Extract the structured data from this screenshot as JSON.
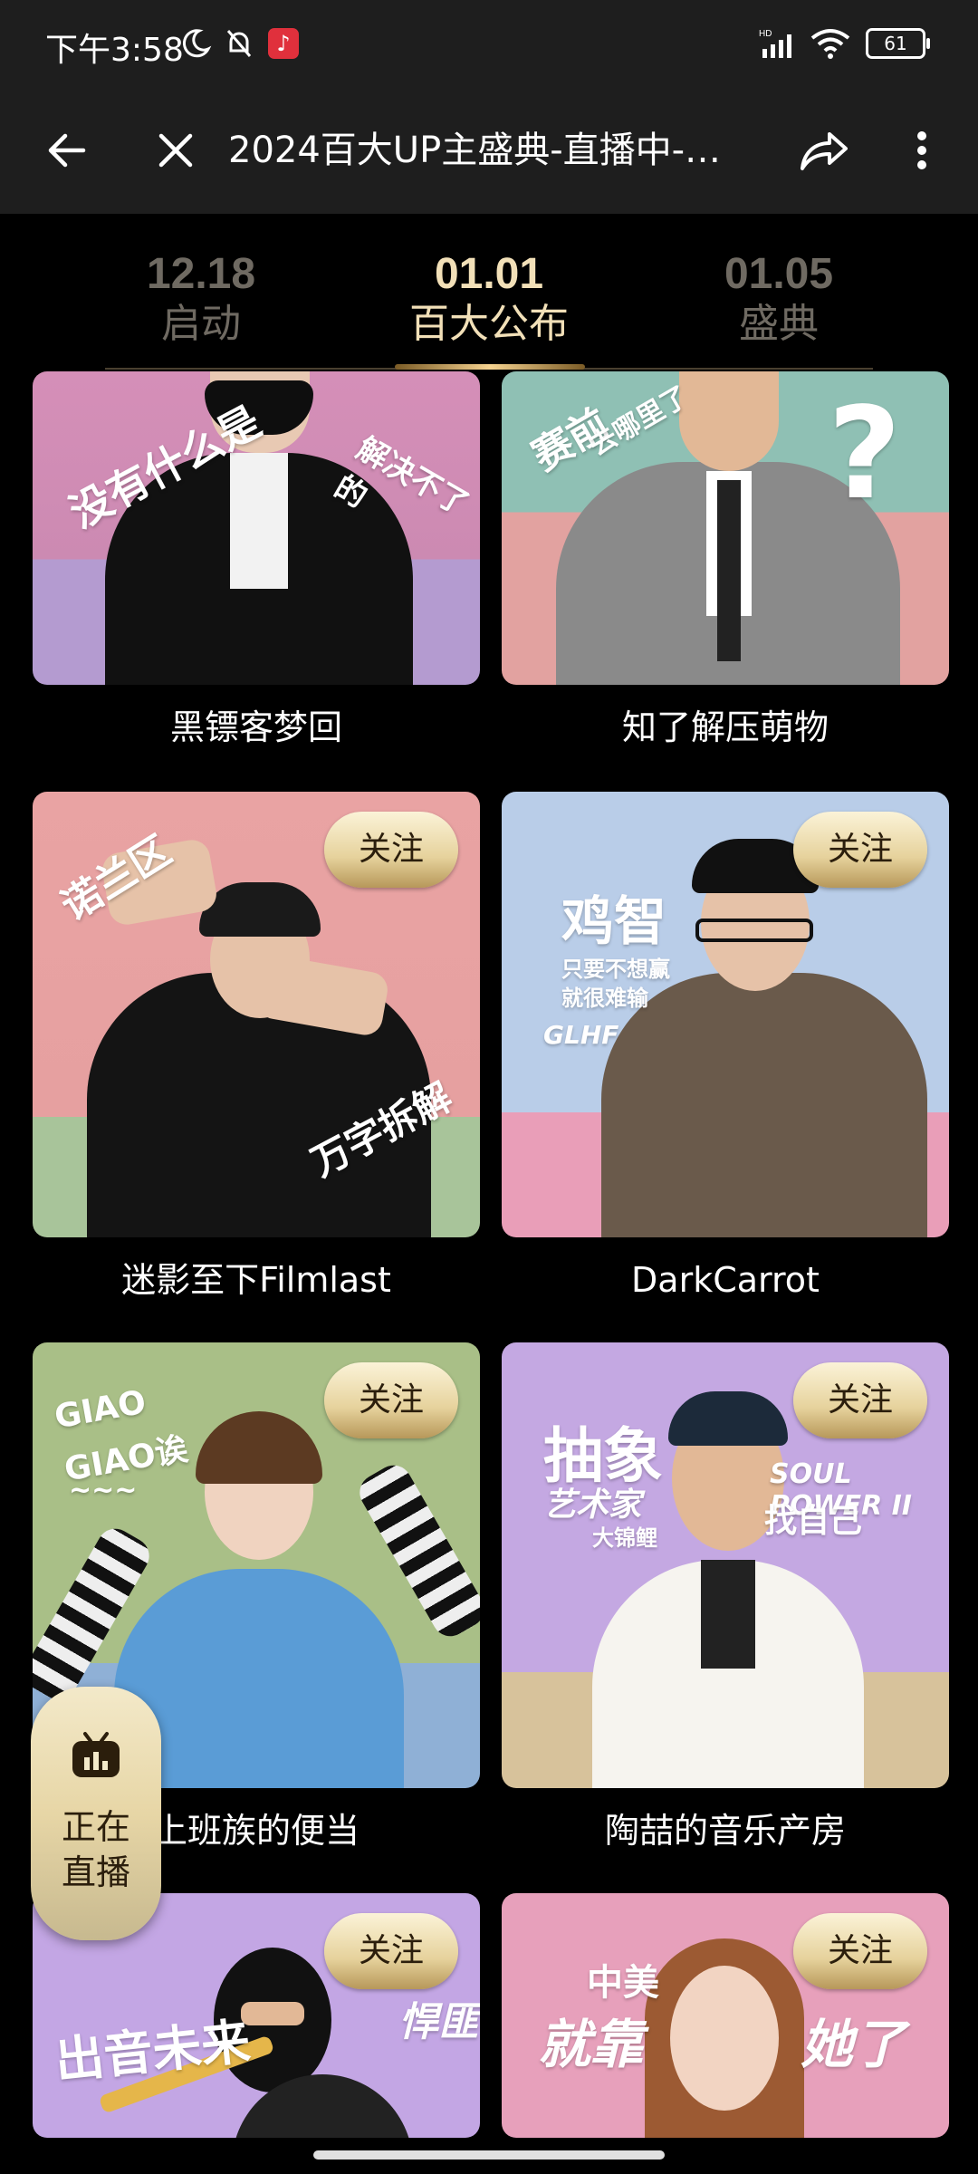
{
  "status_bar": {
    "time": "下午3:58",
    "signal_label": "HD",
    "battery": "61",
    "icons": [
      "moon-icon",
      "bell-off-icon",
      "app-badge-icon",
      "signal-icon",
      "wifi-icon",
      "battery-icon"
    ]
  },
  "toolbar": {
    "title": "2024百大UP主盛典-直播中-…",
    "back": "back-arrow-icon",
    "close": "close-icon",
    "share": "share-icon",
    "more": "more-vertical-icon"
  },
  "tabs": [
    {
      "date": "12.18",
      "label": "启动",
      "active": false
    },
    {
      "date": "01.01",
      "label": "百大公布",
      "active": true
    },
    {
      "date": "01.05",
      "label": "盛典",
      "active": false
    }
  ],
  "cards": [
    {
      "name": "黑镖客梦回",
      "overlay": [
        "没有什么是",
        "解决不了的"
      ],
      "follow": ""
    },
    {
      "name": "知了解压萌物",
      "overlay": [
        "赛前",
        "去哪里了"
      ],
      "follow": ""
    },
    {
      "name": "迷影至下Filmlast",
      "overlay": [
        "诺兰区",
        "万字拆解"
      ],
      "follow": "关注"
    },
    {
      "name": "DarkCarrot",
      "overlay": [
        "鸡智",
        "只要不想赢",
        "就很难输",
        "GLHF"
      ],
      "follow": "关注"
    },
    {
      "name": "上班族的便当",
      "overlay": [
        "GIAO",
        "GIAO诶",
        "~~~"
      ],
      "follow": "关注"
    },
    {
      "name": "陶喆的音乐产房",
      "overlay": [
        "抽象",
        "艺术家",
        "大锦鲤",
        "SOUL POWER II",
        "找自己"
      ],
      "follow": "关注"
    },
    {
      "name": "",
      "overlay": [
        "出音未来",
        "悍匪"
      ],
      "follow": "关注"
    },
    {
      "name": "",
      "overlay": [
        "中美",
        "就靠",
        "她了"
      ],
      "follow": "关注"
    }
  ],
  "live_float": {
    "line1": "正在",
    "line2": "直播",
    "icon": "tv-live-icon"
  },
  "colors": {
    "accent_gold": "#f2e0b8",
    "dim_tab": "#6f6a62",
    "background": "#000000"
  }
}
